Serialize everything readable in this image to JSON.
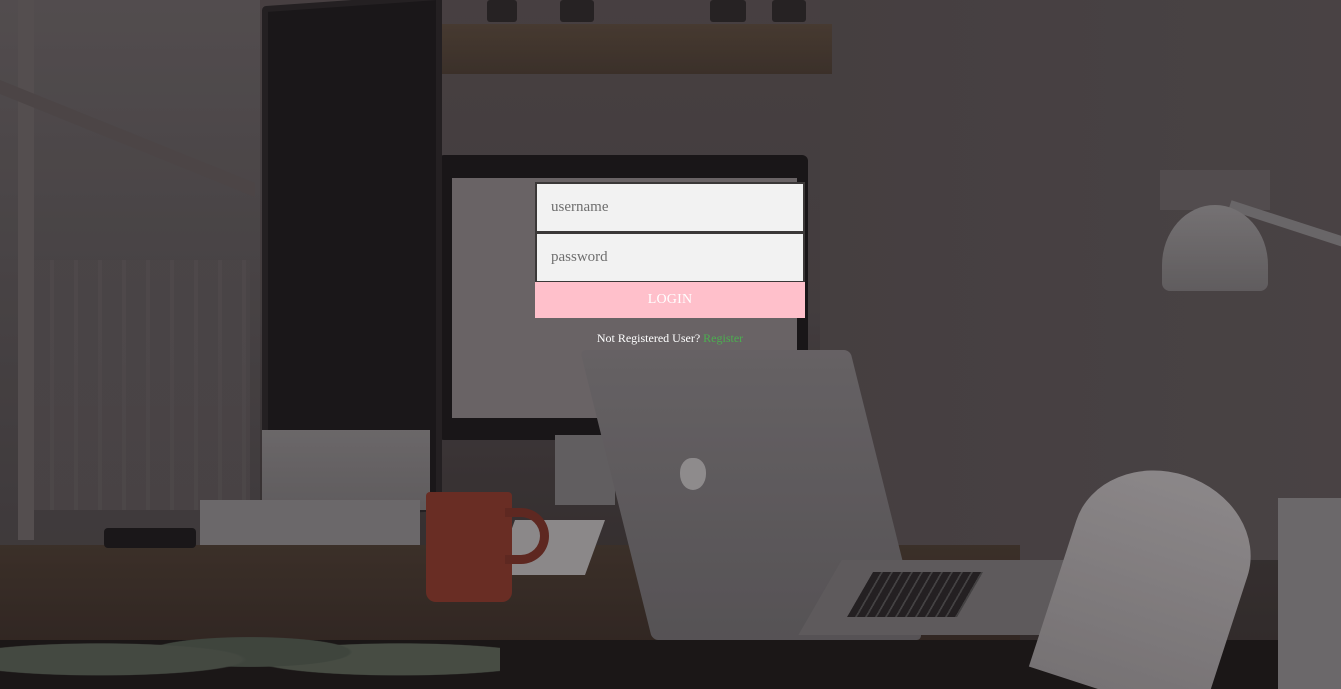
{
  "login": {
    "username_placeholder": "username",
    "password_placeholder": "password",
    "button_label": "LOGIN",
    "register_prompt": "Not Registered User?",
    "register_link": "Register"
  },
  "colors": {
    "button_background": "#ffc0cb",
    "button_text": "#ffffff",
    "input_background": "#f2f2f2",
    "link": "#4caf50",
    "prompt_text": "#ffffff"
  }
}
